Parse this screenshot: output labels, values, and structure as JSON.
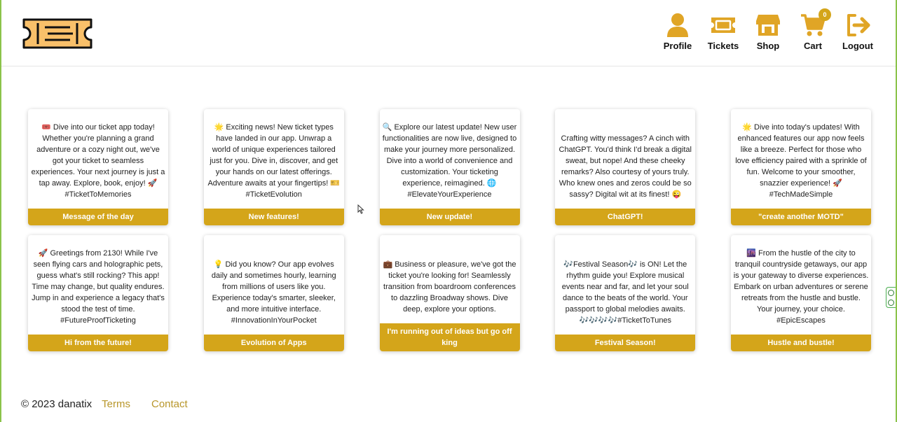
{
  "header": {
    "logo_icon": "ticket-icon",
    "nav": [
      {
        "label": "Profile",
        "icon": "user-icon"
      },
      {
        "label": "Tickets",
        "icon": "ticket-icon"
      },
      {
        "label": "Shop",
        "icon": "store-icon"
      },
      {
        "label": "Cart",
        "icon": "cart-icon",
        "badge": "0"
      },
      {
        "label": "Logout",
        "icon": "logout-icon"
      }
    ]
  },
  "cards": [
    {
      "text": "🎟️ Dive into our ticket app today! Whether you're planning a grand adventure or a cozy night out, we've got your ticket to seamless experiences. Your next journey is just a tap away. Explore, book, enjoy! 🚀 #TicketToMemories",
      "title": "Message of the day"
    },
    {
      "text": "🌟 Exciting news! New ticket types have landed in our app. Unwrap a world of unique experiences tailored just for you. Dive in, discover, and get your hands on our latest offerings. Adventure awaits at your fingertips! 🎫 #TicketEvolution",
      "title": "New features!"
    },
    {
      "text": "🔍 Explore our latest update! New user functionalities are now live, designed to make your journey more personalized. Dive into a world of convenience and customization. Your ticketing experience, reimagined. 🌐 #ElevateYourExperience",
      "title": "New update!"
    },
    {
      "text": "Crafting witty messages? A cinch with ChatGPT. You'd think I'd break a digital sweat, but nope! And these cheeky remarks? Also courtesy of yours truly. Who knew ones and zeros could be so sassy? Digital wit at its finest! 😜",
      "title": "ChatGPT!"
    },
    {
      "text": "🌟 Dive into today's updates! With enhanced features our app now feels like a breeze. Perfect for those who love efficiency paired with a sprinkle of fun. Welcome to your smoother, snazzier experience! 🚀 #TechMadeSimple",
      "title": "\"create another MOTD\""
    },
    {
      "text": "🚀 Greetings from 2130! While I've seen flying cars and holographic pets, guess what's still rocking? This app! Time may change, but quality endures. Jump in and experience a legacy that's stood the test of time. #FutureProofTicketing",
      "title": "Hi from the future!"
    },
    {
      "text": "💡 Did you know? Our app evolves daily and sometimes hourly, learning from millions of users like you. Experience today's smarter, sleeker, and more intuitive interface. #InnovationInYourPocket",
      "title": "Evolution of Apps"
    },
    {
      "text": "💼 Business or pleasure, we've got the ticket you're looking for! Seamlessly transition from boardroom conferences to dazzling Broadway shows. Dive deep, explore your options.",
      "title": "I'm running out of ideas but go off king"
    },
    {
      "text": "🎶Festival Season🎶 is ON! Let the rhythm guide you! Explore musical events near and far, and let your soul dance to the beats of the world. Your passport to global melodies awaits. 🎶🎶🎶🎶#TicketToTunes",
      "title": "Festival Season!"
    },
    {
      "text": "🌆 From the hustle of the city to tranquil countryside getaways, our app is your gateway to diverse experiences. Embark on urban adventures or serene retreats from the hustle and bustle. Your journey, your choice. #EpicEscapes",
      "title": "Hustle and bustle!"
    }
  ],
  "footer": {
    "copyright": "© 2023 danatix",
    "terms": "Terms",
    "contact": "Contact"
  },
  "colors": {
    "accent": "#d4a51a",
    "logo_fill": "#f9c06a"
  }
}
